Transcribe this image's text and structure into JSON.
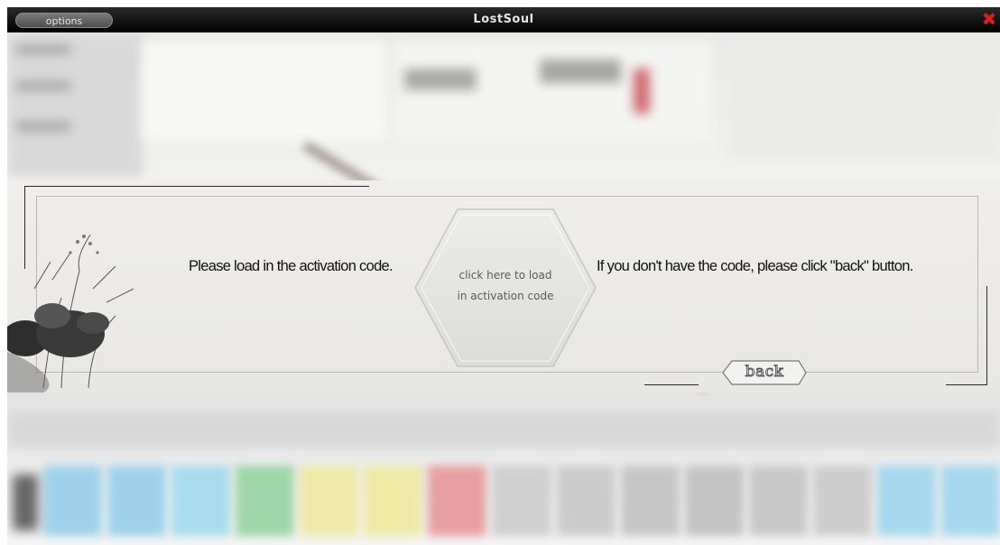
{
  "window": {
    "title": "LostSoul",
    "options_label": "options",
    "close_icon": "close-icon"
  },
  "activation": {
    "left_message": "Please load in the activation code.",
    "right_message": "If you don't have the code, please click \"back\" button.",
    "load_button_line1": "click here to load",
    "load_button_line2": "in activation code",
    "back_label": "back"
  },
  "colors": {
    "titlebar": "#000000",
    "close_icon": "#d02020",
    "panel": "#ecebe7"
  }
}
